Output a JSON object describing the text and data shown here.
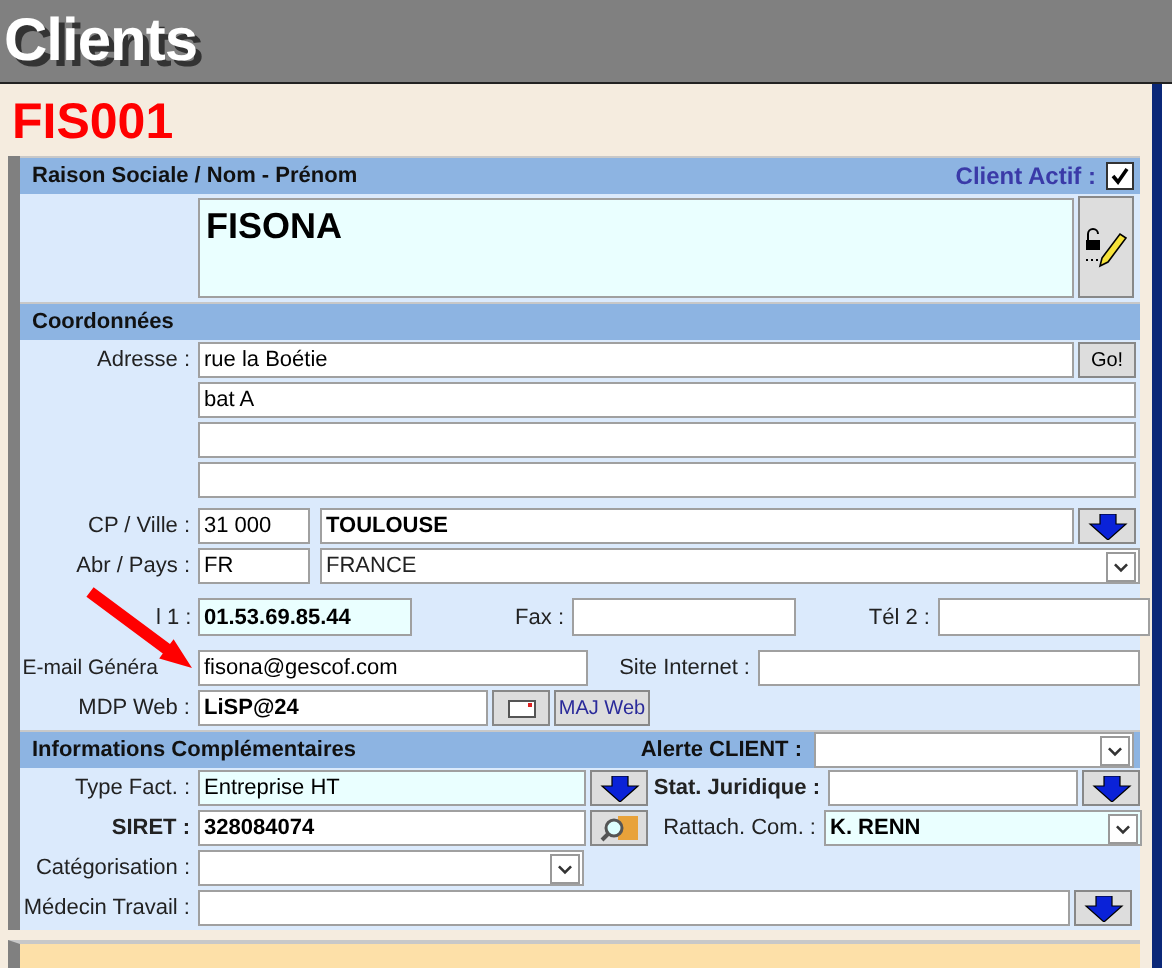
{
  "title": "Clients",
  "code": "FIS001",
  "identity": {
    "header": "Raison Sociale / Nom - Prénom",
    "active_label": "Client Actif :",
    "active": true,
    "name": "FISONA"
  },
  "contact": {
    "header": "Coordonnées",
    "address_label": "Adresse :",
    "address_lines": [
      "rue la Boétie",
      "bat A"
    ],
    "go_button": "Go!",
    "cp_label": "CP / Ville :",
    "cp": "31 000",
    "city": "TOULOUSE",
    "country_label": "Abr / Pays :",
    "country_code": "FR",
    "country": "FRANCE",
    "tel1_label": "l 1 :",
    "tel1": "01.53.69.85.44",
    "fax_label": "Fax :",
    "tel2_label": "Tél 2 :",
    "email_label": "E-mail Généra",
    "email": "fisona@gescof.com",
    "site_label": "Site Internet :",
    "password_label": "MDP Web :",
    "password": "LiSP@24",
    "update_button": "MAJ Web"
  },
  "info": {
    "header": "Informations Complémentaires",
    "alert_label": "Alerte CLIENT :",
    "billing_label": "Type Fact. :",
    "billing": "Entreprise HT",
    "legal_label": "Stat. Juridique :",
    "siret_label": "SIRET :",
    "siret": "328084074",
    "sales_label": "Rattach. Com. :",
    "sales": "K. RENN",
    "category_label": "Catégorisation :",
    "doctor_label": "Médecin Travail :"
  }
}
